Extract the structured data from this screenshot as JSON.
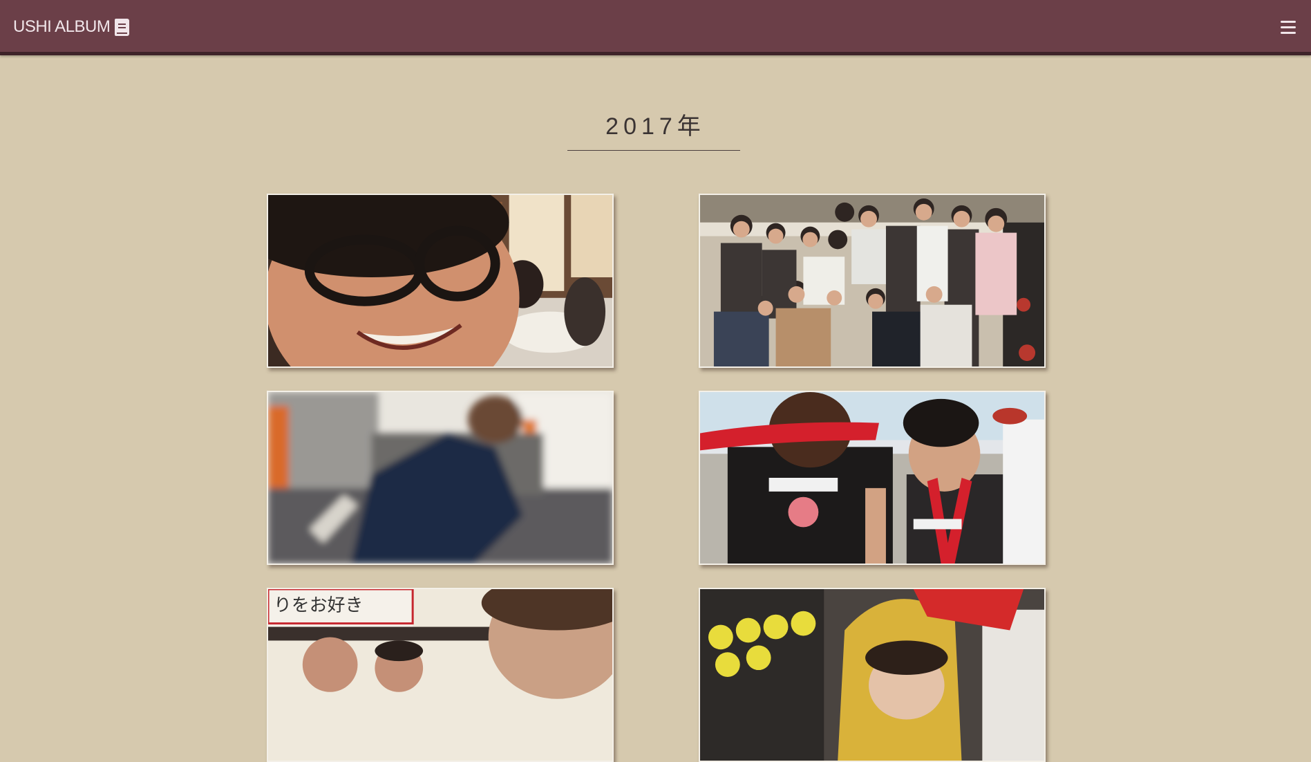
{
  "navbar": {
    "brand_text": "USHI ALBUM",
    "brand_icon": "book-icon",
    "menu_icon": "hamburger-menu-icon",
    "background_color": "#6b3f48"
  },
  "section": {
    "title": "2017年"
  },
  "photos": [
    {
      "id": "photo-1",
      "subject": "blurry close-up face with glasses at a restaurant"
    },
    {
      "id": "photo-2",
      "subject": "large group photo at bowling alley"
    },
    {
      "id": "photo-3",
      "subject": "motion-blurred person in navy shirt"
    },
    {
      "id": "photo-4",
      "subject": "people with red scarves at an outdoor event"
    },
    {
      "id": "photo-5",
      "subject": "close-up selfie in a shop"
    },
    {
      "id": "photo-6",
      "subject": "person in yellow costume hat"
    }
  ],
  "colors": {
    "page_background": "#d6c9ae",
    "photo_border": "#f4f0e8"
  }
}
